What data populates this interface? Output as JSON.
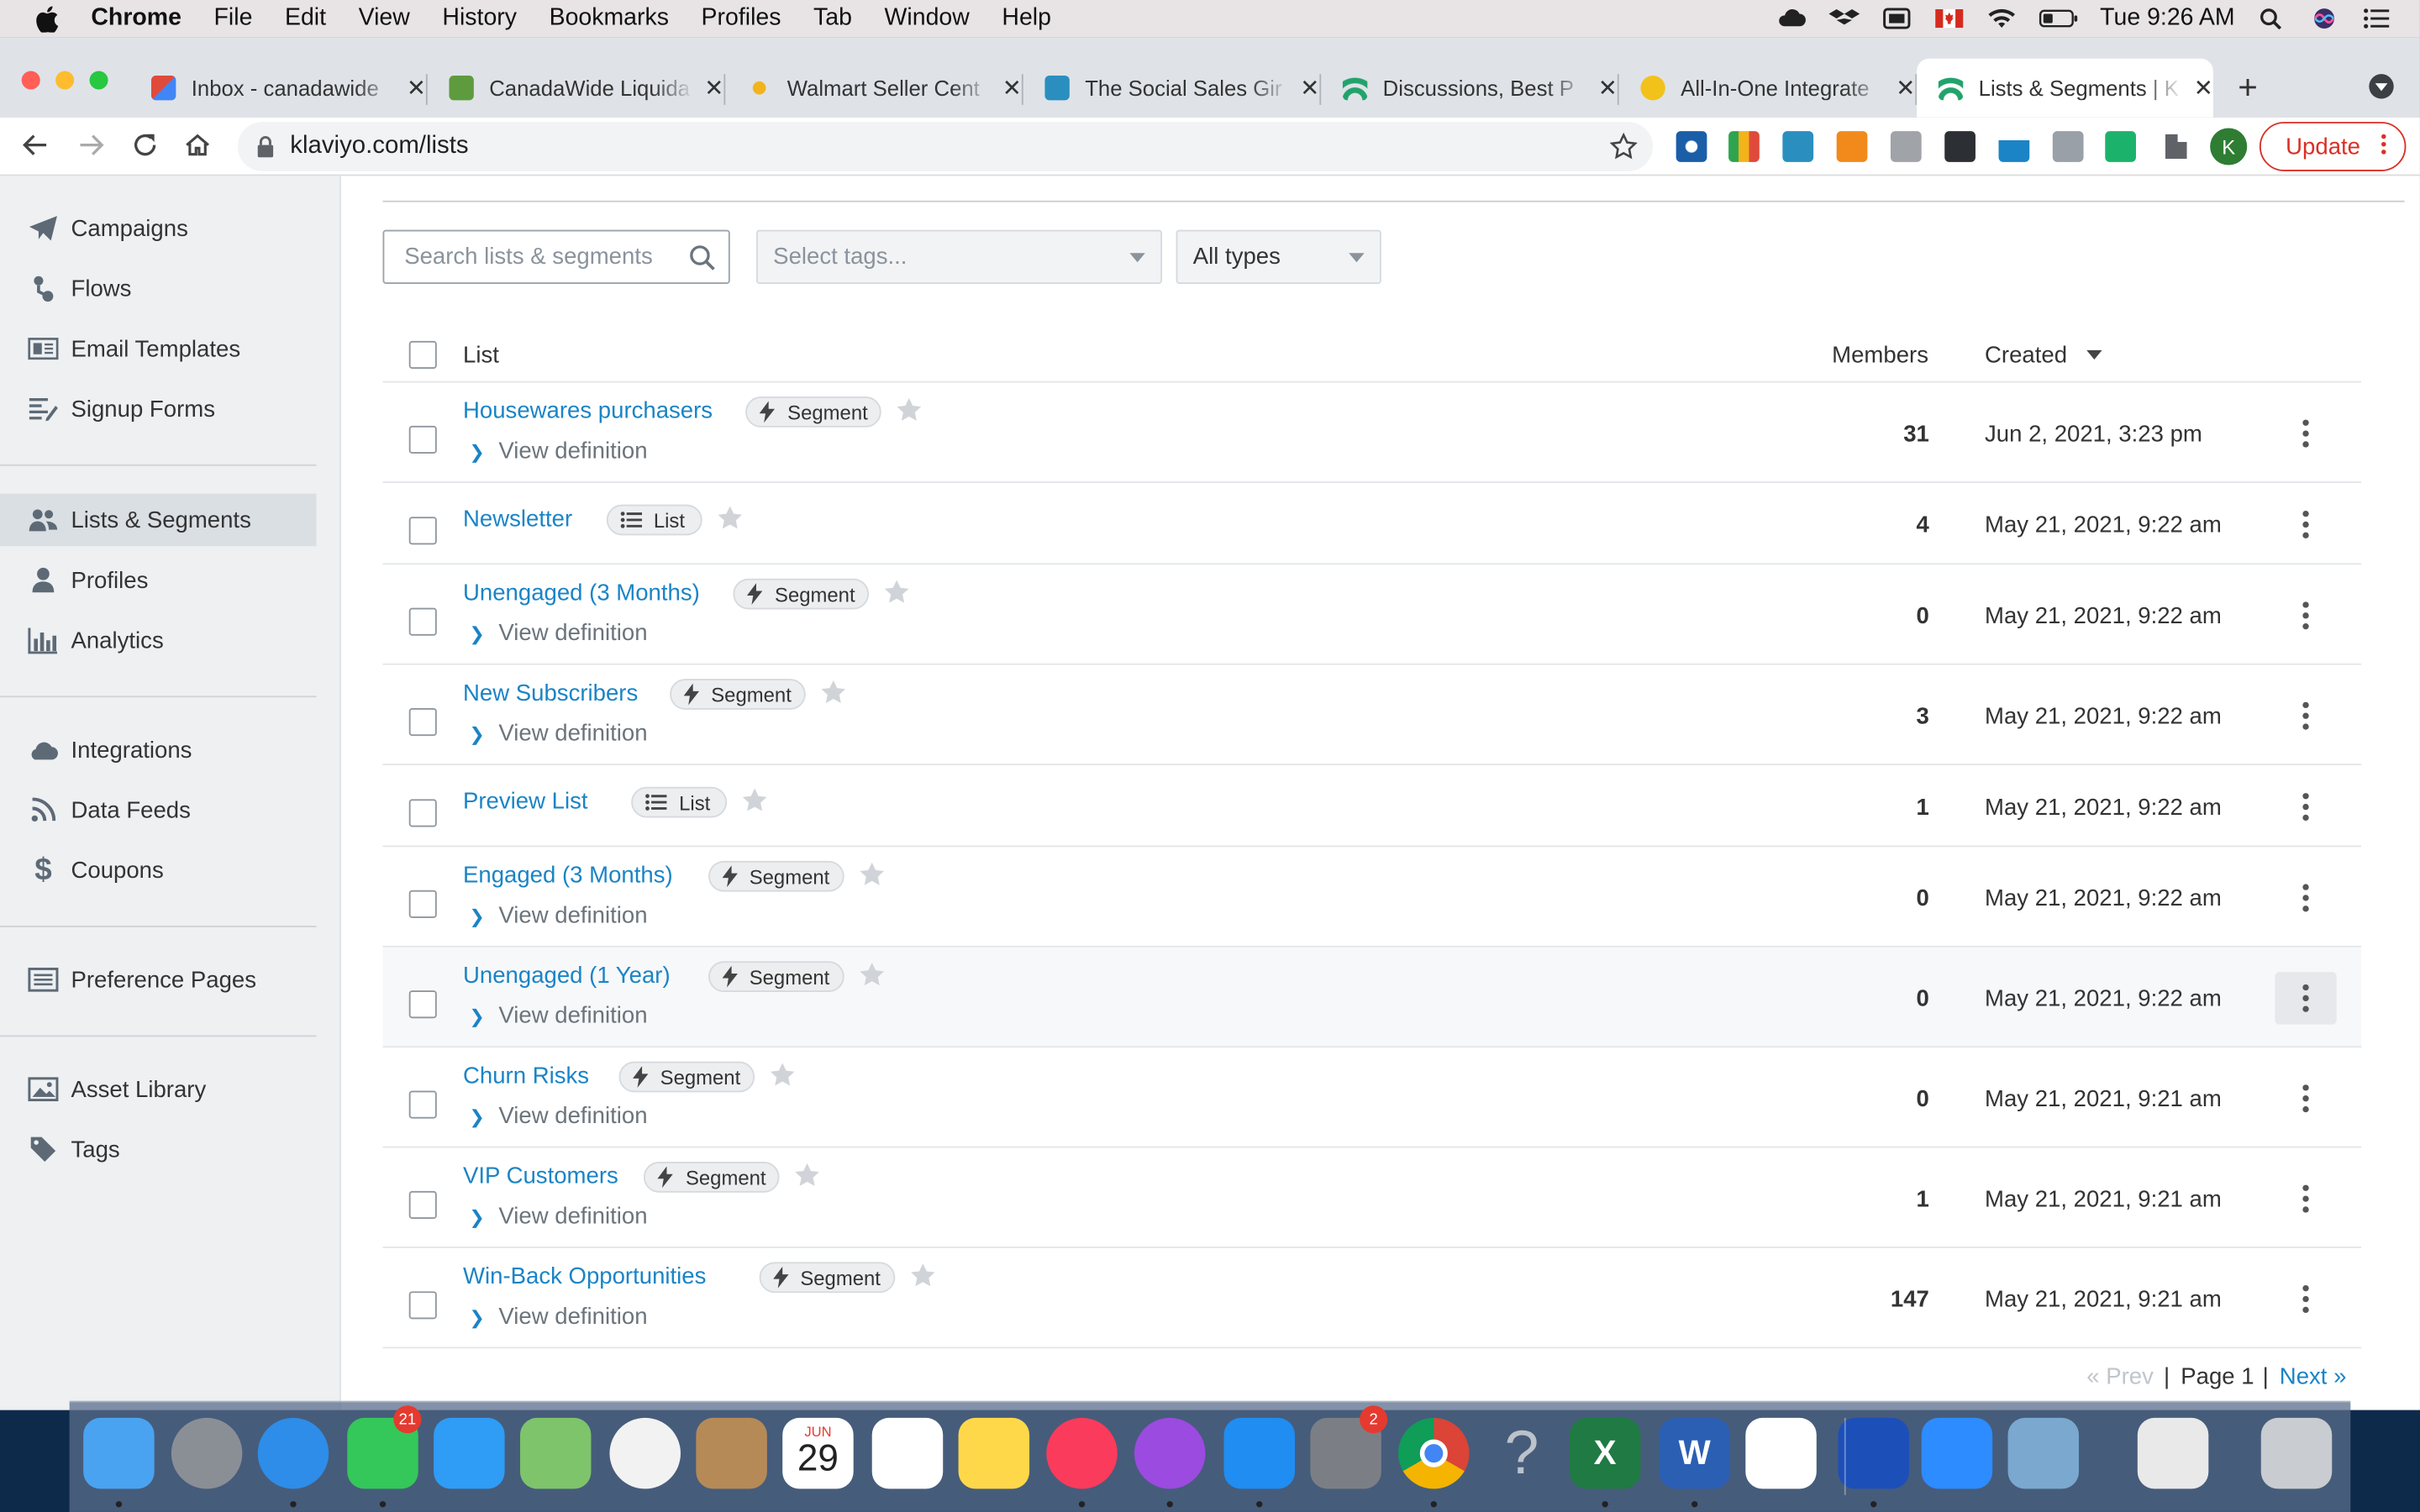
{
  "menubar": {
    "app": "Chrome",
    "items": [
      "File",
      "Edit",
      "View",
      "History",
      "Bookmarks",
      "Profiles",
      "Tab",
      "Window",
      "Help"
    ],
    "clock": "Tue 9:26 AM"
  },
  "tabs": [
    {
      "title": "Inbox - canadawide",
      "color": "#e04a3a"
    },
    {
      "title": "CanadaWide Liquida",
      "color": "#5e9b3f"
    },
    {
      "title": "Walmart Seller Cent",
      "color": "#f2b31b"
    },
    {
      "title": "The Social Sales Gir",
      "color": "#2a8fbf"
    },
    {
      "title": "Discussions, Best P",
      "color": "#22a36b"
    },
    {
      "title": "All-In-One Integrate",
      "color": "#f2c21b"
    },
    {
      "title": "Lists & Segments | K",
      "color": "#22a36b"
    }
  ],
  "address": {
    "url": "klaviyo.com/lists",
    "update_label": "Update",
    "profile_initial": "K"
  },
  "sidebar": {
    "items": [
      {
        "label": "Campaigns",
        "icon": "paper-plane-icon"
      },
      {
        "label": "Flows",
        "icon": "flow-icon"
      },
      {
        "label": "Email Templates",
        "icon": "template-icon"
      },
      {
        "label": "Signup Forms",
        "icon": "form-icon"
      },
      {
        "label": "Lists & Segments",
        "icon": "users-icon"
      },
      {
        "label": "Profiles",
        "icon": "user-icon"
      },
      {
        "label": "Analytics",
        "icon": "bar-chart-icon"
      },
      {
        "label": "Integrations",
        "icon": "cloud-icon"
      },
      {
        "label": "Data Feeds",
        "icon": "rss-icon"
      },
      {
        "label": "Coupons",
        "icon": "dollar-icon"
      },
      {
        "label": "Preference Pages",
        "icon": "list-window-icon"
      },
      {
        "label": "Asset Library",
        "icon": "image-icon"
      },
      {
        "label": "Tags",
        "icon": "tag-icon"
      }
    ]
  },
  "filters": {
    "search_placeholder": "Search lists & segments",
    "tags_placeholder": "Select tags...",
    "type_value": "All types"
  },
  "table": {
    "col_list": "List",
    "col_members": "Members",
    "col_created": "Created",
    "view_definition": "View definition",
    "rows": [
      {
        "name": "Housewares purchasers",
        "type": "Segment",
        "members": "31",
        "created": "Jun 2, 2021, 3:23 pm"
      },
      {
        "name": "Newsletter",
        "type": "List",
        "members": "4",
        "created": "May 21, 2021, 9:22 am"
      },
      {
        "name": "Unengaged (3 Months)",
        "type": "Segment",
        "members": "0",
        "created": "May 21, 2021, 9:22 am"
      },
      {
        "name": "New Subscribers",
        "type": "Segment",
        "members": "3",
        "created": "May 21, 2021, 9:22 am"
      },
      {
        "name": "Preview List",
        "type": "List",
        "members": "1",
        "created": "May 21, 2021, 9:22 am"
      },
      {
        "name": "Engaged (3 Months)",
        "type": "Segment",
        "members": "0",
        "created": "May 21, 2021, 9:22 am"
      },
      {
        "name": "Unengaged (1 Year)",
        "type": "Segment",
        "members": "0",
        "created": "May 21, 2021, 9:22 am"
      },
      {
        "name": "Churn Risks",
        "type": "Segment",
        "members": "0",
        "created": "May 21, 2021, 9:21 am"
      },
      {
        "name": "VIP Customers",
        "type": "Segment",
        "members": "1",
        "created": "May 21, 2021, 9:21 am"
      },
      {
        "name": "Win-Back Opportunities",
        "type": "Segment",
        "members": "147",
        "created": "May 21, 2021, 9:21 am"
      }
    ]
  },
  "pager": {
    "prev": "« Prev",
    "page": "Page 1",
    "next": "Next »"
  },
  "dock": {
    "calendar_month": "JUN",
    "calendar_day": "29",
    "facetime_badge": "21",
    "settings_badge": "2",
    "apps": [
      {
        "name": "finder-icon",
        "color": "#4aa3f0"
      },
      {
        "name": "launchpad-icon",
        "color": "#8a8f96"
      },
      {
        "name": "safari-icon",
        "color": "#2d8de8"
      },
      {
        "name": "facetime-icon",
        "color": "#34c759"
      },
      {
        "name": "messages-icon",
        "color": "#2f9cf5"
      },
      {
        "name": "maps-icon",
        "color": "#7ec46b"
      },
      {
        "name": "photos-icon",
        "color": "#f2f2f2"
      },
      {
        "name": "contacts-icon",
        "color": "#b58a57"
      },
      {
        "name": "calendar-icon",
        "color": "#ffffff"
      },
      {
        "name": "reminders-icon",
        "color": "#ffffff"
      },
      {
        "name": "notes-icon",
        "color": "#ffd84a"
      },
      {
        "name": "music-icon",
        "color": "#fb3b5c"
      },
      {
        "name": "podcasts-icon",
        "color": "#9b4be0"
      },
      {
        "name": "app-store-icon",
        "color": "#1f8df2"
      },
      {
        "name": "system-preferences-icon",
        "color": "#7b7f85"
      },
      {
        "name": "chrome-icon",
        "color": "#e8e8e8"
      },
      {
        "name": "help-icon",
        "color": "#9aa0a8"
      },
      {
        "name": "excel-icon",
        "color": "#1f7a43"
      },
      {
        "name": "word-icon",
        "color": "#2b5fb4"
      },
      {
        "name": "onedrive-icon",
        "color": "#ffffff"
      },
      {
        "name": "dropbox-icon",
        "color": "#1d4fb8"
      },
      {
        "name": "zoom-icon",
        "color": "#2d8cff"
      },
      {
        "name": "preview-icon",
        "color": "#7aa8cf"
      },
      {
        "name": "documents-icon",
        "color": "#e9e9e9"
      },
      {
        "name": "trash-icon",
        "color": "#c9ccd0"
      }
    ]
  }
}
